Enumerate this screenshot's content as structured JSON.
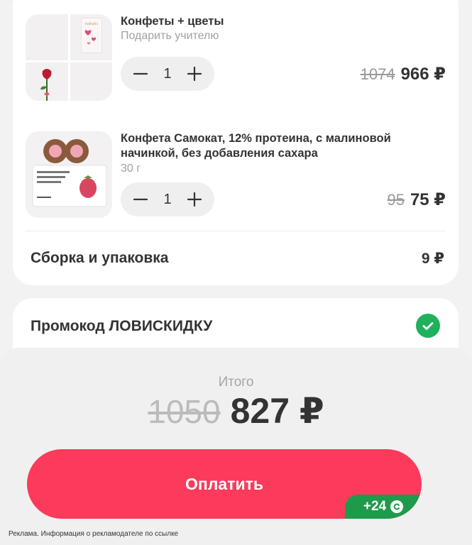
{
  "cart": {
    "items": [
      {
        "title": "Конфеты + цветы",
        "subtitle": "Подарить учителю",
        "quantity": "1",
        "old_price": "1074",
        "new_price": "966 ₽",
        "thumb_label": "Raffaello"
      },
      {
        "title": "Конфета Самокат, 12% протеина, с малиновой начинкой, без добавления сахара",
        "subtitle": "30 г",
        "quantity": "1",
        "old_price": "95",
        "new_price": "75 ₽"
      }
    ],
    "assembly": {
      "label": "Сборка и упаковка",
      "price": "9 ₽"
    }
  },
  "promo": {
    "label": "Промокод ЛОВИСКИДКУ",
    "status_icon": "check-circle-icon"
  },
  "total": {
    "label": "Итого",
    "old_price": "1050",
    "new_price": "827 ₽"
  },
  "pay_button": {
    "label": "Оплатить",
    "bonus": "+24"
  },
  "ad_note": "Реклама. Информация о рекламодателе по ссылке",
  "colors": {
    "accent": "#fb3a5c",
    "bonus_green": "#1e9a4b",
    "check_green": "#1fb15b"
  }
}
